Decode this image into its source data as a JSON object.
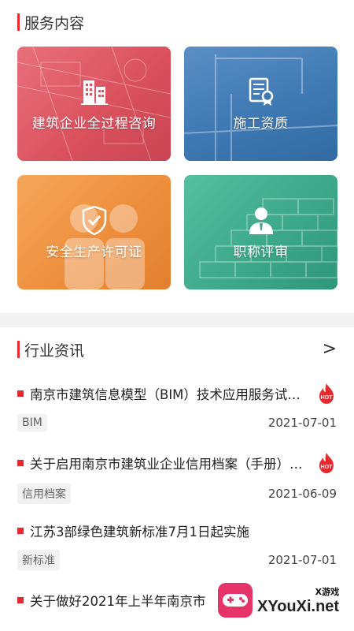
{
  "services": {
    "title": "服务内容",
    "cards": [
      {
        "label": "建筑企业全过程咨询",
        "icon": "building-icon",
        "color": "#d9505c"
      },
      {
        "label": "施工资质",
        "icon": "certificate-icon",
        "color": "#3f79b3"
      },
      {
        "label": "安全生产许可证",
        "icon": "shield-check-icon",
        "color": "#ee8f3d"
      },
      {
        "label": "职称评审",
        "icon": "person-icon",
        "color": "#3ea98a"
      }
    ]
  },
  "news": {
    "title": "行业资讯",
    "more_label": ">",
    "items": [
      {
        "title": "南京市建筑信息模型（BIM）技术应用服务试点项目",
        "tag": "BIM",
        "date": "2021-07-01",
        "hot": true,
        "hot_label": "HOT"
      },
      {
        "title": "关于启用南京市建筑业企业信用档案（手册）的通知",
        "tag": "信用档案",
        "date": "2021-06-09",
        "hot": true,
        "hot_label": "HOT"
      },
      {
        "title": "江苏3部绿色建筑新标准7月1日起实施",
        "tag": "新标准",
        "date": "2021-07-01",
        "hot": false
      },
      {
        "title": "关于做好2021年上半年南京市",
        "tag": "",
        "date": "",
        "hot": false
      }
    ]
  },
  "watermark": {
    "small": "X游戏",
    "big": "XYouXi.net"
  },
  "colors": {
    "accent": "#e6282f"
  }
}
